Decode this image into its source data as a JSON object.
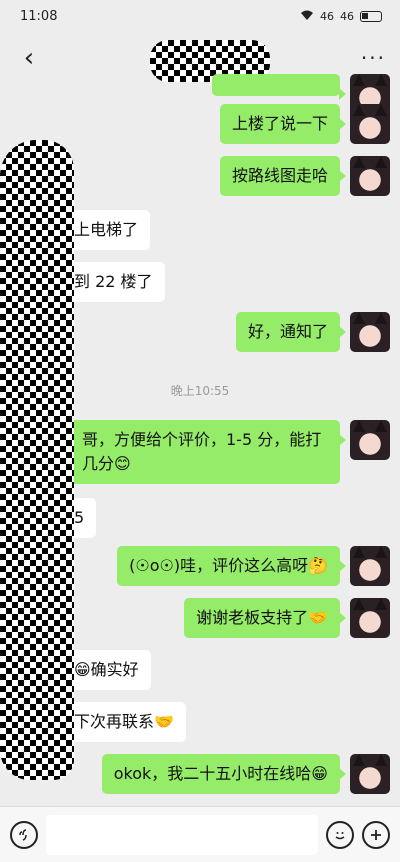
{
  "status_bar": {
    "time": "11:08",
    "battery_icon": "battery-icon",
    "signal_text": "46"
  },
  "nav": {
    "back_icon": "‹",
    "more_icon": "···"
  },
  "chat": {
    "top_clip_visible": true,
    "messages": [
      {
        "side": "right",
        "text": "上楼了说一下"
      },
      {
        "side": "right",
        "text": "按路线图走哈"
      },
      {
        "side": "left",
        "text": "上电梯了"
      },
      {
        "side": "left",
        "text": "到 22 楼了"
      },
      {
        "side": "right",
        "text": "好，通知了"
      },
      {
        "side": "right",
        "text": "哥，方便给个评价，1-5 分，能打几分😊"
      },
      {
        "side": "left",
        "text": "5"
      },
      {
        "side": "right",
        "text": "(☉o☉)哇，评价这么高呀🤔"
      },
      {
        "side": "right",
        "text": "谢谢老板支持了🤝"
      },
      {
        "side": "left",
        "text": "😁确实好"
      },
      {
        "side": "left",
        "text": "下次再联系🤝"
      },
      {
        "side": "right",
        "text": "okok，我二十五小时在线哈😁"
      }
    ],
    "timestamp": "晚上10:55"
  },
  "input_bar": {
    "voice_icon": "voice-icon",
    "emoji_icon": "emoji-icon",
    "plus_icon": "plus-icon"
  }
}
